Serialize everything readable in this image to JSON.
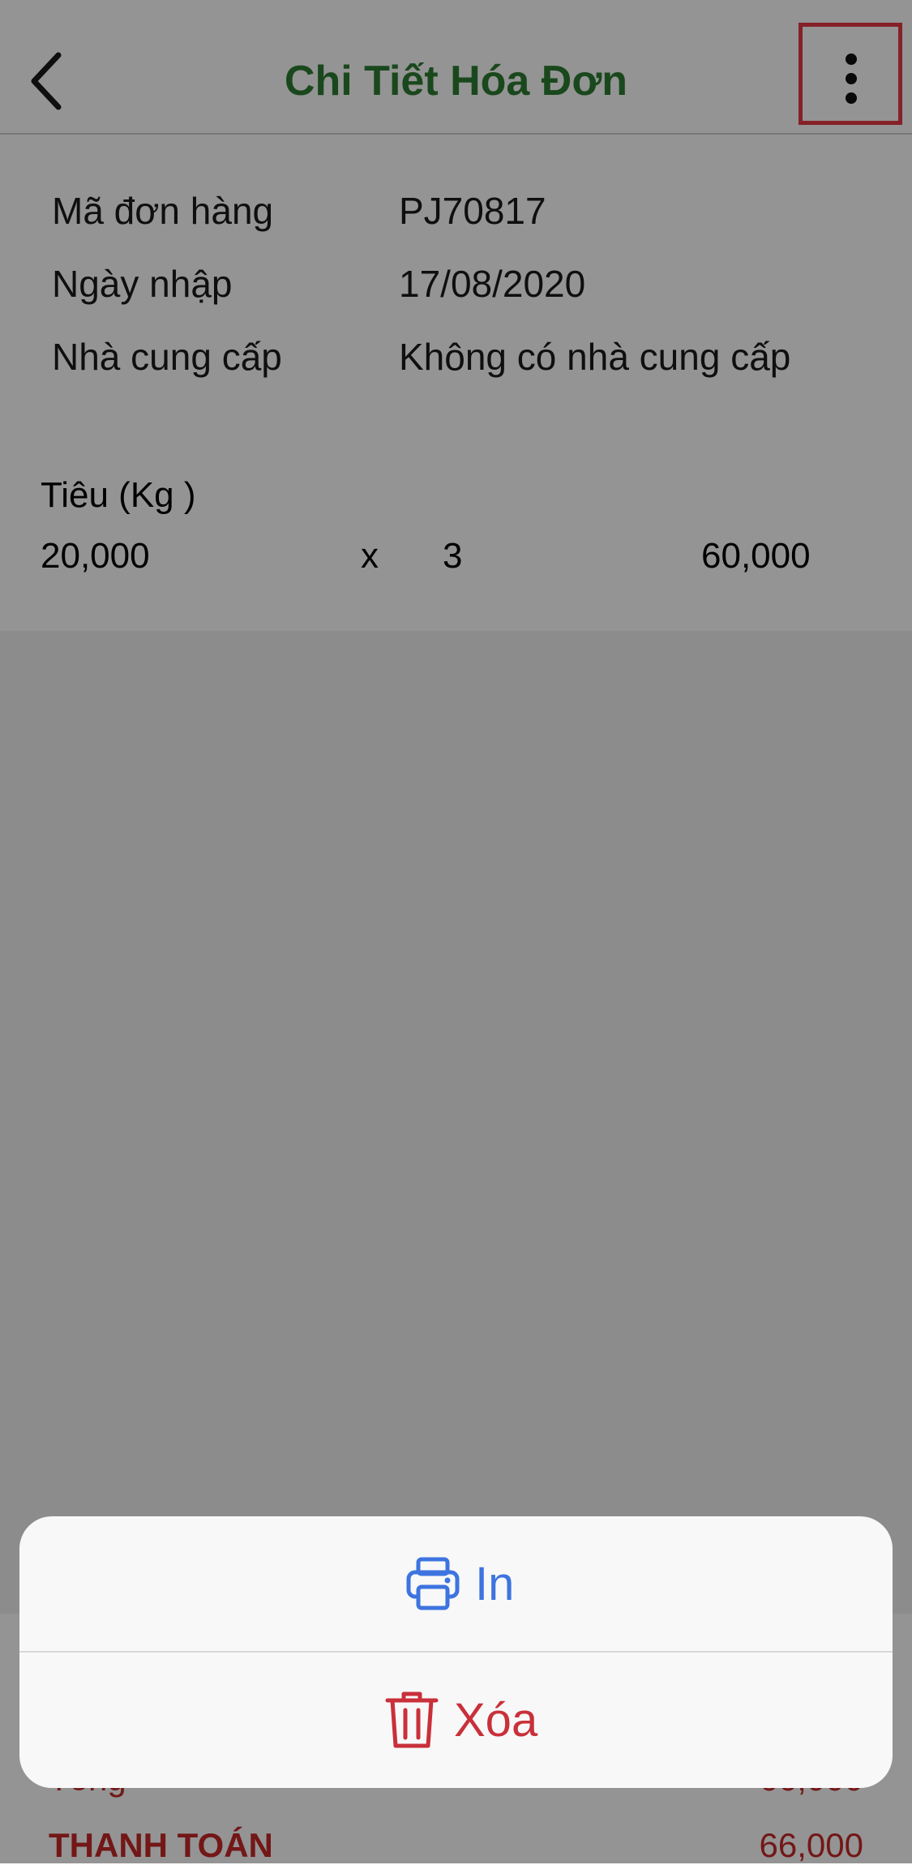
{
  "header": {
    "title": "Chi Tiết Hóa Đơn"
  },
  "order": {
    "fields": [
      {
        "label": "Mã đơn hàng",
        "value": "PJ70817"
      },
      {
        "label": "Ngày nhập",
        "value": "17/08/2020"
      },
      {
        "label": "Nhà cung cấp",
        "value": "Không có nhà cung cấp"
      }
    ]
  },
  "items": [
    {
      "name": "Tiêu (Kg )",
      "price": "20,000",
      "times": "x",
      "qty": "3",
      "total": "60,000"
    }
  ],
  "summary": {
    "subtotal_label": "Tổng",
    "subtotal_value": "66,000",
    "pay_label": "THANH TOÁN",
    "pay_value": "66,000"
  },
  "action_sheet": {
    "print_label": "In",
    "delete_label": "Xóa"
  },
  "colors": {
    "title_green": "#2e7d32",
    "print_blue": "#3d74e0",
    "delete_red": "#c9303a",
    "highlight_red": "#e53945"
  },
  "icons": {
    "back": "chevron-left-icon",
    "more": "more-vertical-icon",
    "print": "printer-icon",
    "delete": "trash-icon"
  }
}
